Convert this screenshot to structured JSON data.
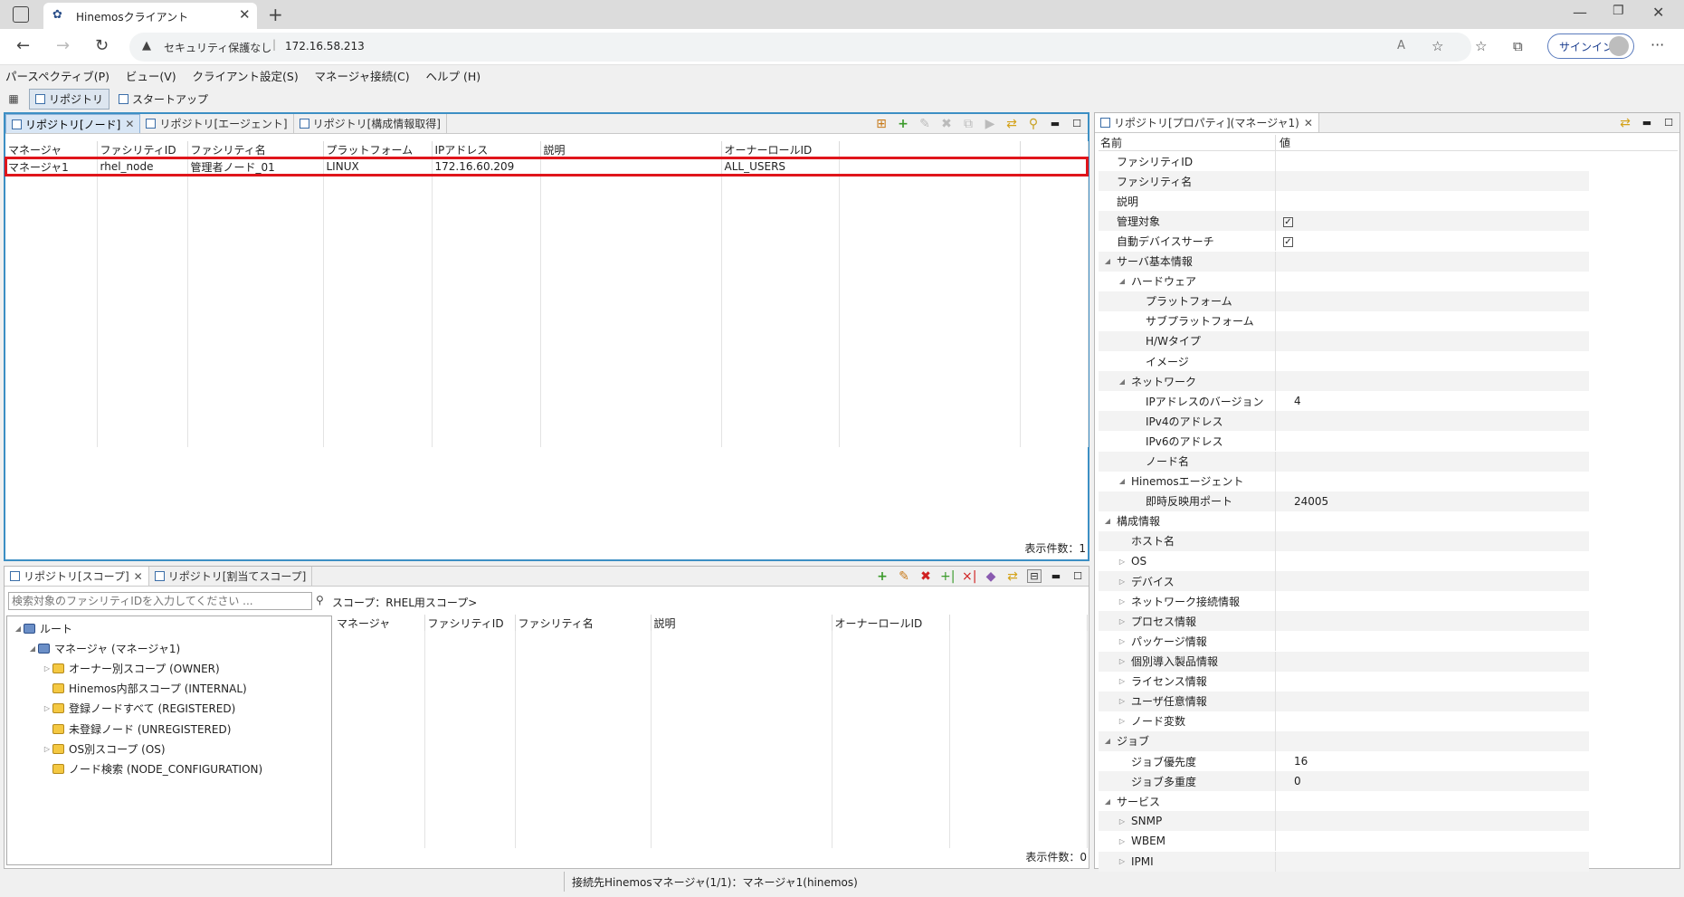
{
  "browser": {
    "tab_title": "Hinemosクライアント",
    "security_label": "セキュリティ保護なし",
    "url": "172.16.58.213",
    "signin_label": "サインイン"
  },
  "menubar": [
    "パースペクティブ(P)",
    "ビュー(V)",
    "クライアント設定(S)",
    "マネージャ接続(C)",
    "ヘルプ (H)"
  ],
  "perspectives": [
    "リポジトリ",
    "スタートアップ"
  ],
  "node_view": {
    "tabs": [
      "リポジトリ[ノード]",
      "リポジトリ[エージェント]",
      "リポジトリ[構成情報取得]"
    ],
    "columns": [
      "マネージャ",
      "ファシリティID",
      "ファシリティ名",
      "プラットフォーム",
      "IPアドレス",
      "説明",
      "オーナーロールID"
    ],
    "rows": [
      [
        "マネージャ1",
        "rhel_node",
        "管理者ノード_01",
        "LINUX",
        "172.16.60.209",
        "",
        "ALL_USERS"
      ]
    ],
    "count_label": "表示件数：1"
  },
  "scope_view": {
    "tabs": [
      "リポジトリ[スコープ]",
      "リポジトリ[割当てスコープ]"
    ],
    "search_placeholder": "検索対象のファシリティIDを入力してください ...",
    "scope_label": "スコープ：RHEL用スコープ>",
    "tree": [
      {
        "label": "ルート",
        "level": 0,
        "expander": "◢",
        "icon": "root"
      },
      {
        "label": "マネージャ (マネージャ1)",
        "level": 1,
        "expander": "◢",
        "icon": "manager"
      },
      {
        "label": "オーナー別スコープ (OWNER)",
        "level": 2,
        "expander": "▷",
        "icon": "folder"
      },
      {
        "label": "Hinemos内部スコープ (INTERNAL)",
        "level": 2,
        "expander": "",
        "icon": "folder"
      },
      {
        "label": "登録ノードすべて (REGISTERED)",
        "level": 2,
        "expander": "▷",
        "icon": "folder"
      },
      {
        "label": "未登録ノード (UNREGISTERED)",
        "level": 2,
        "expander": "",
        "icon": "folder"
      },
      {
        "label": "OS別スコープ (OS)",
        "level": 2,
        "expander": "▷",
        "icon": "folder"
      },
      {
        "label": "ノード検索 (NODE_CONFIGURATION)",
        "level": 2,
        "expander": "",
        "icon": "folder"
      }
    ],
    "columns": [
      "マネージャ",
      "ファシリティID",
      "ファシリティ名",
      "説明",
      "オーナーロールID"
    ],
    "count_label": "表示件数：0"
  },
  "property_view": {
    "tab": "リポジトリ[プロパティ](マネージャ1)",
    "col_name": "名前",
    "col_value": "値",
    "rows": [
      {
        "name": "ファシリティID",
        "level": 0,
        "expander": "",
        "value": ""
      },
      {
        "name": "ファシリティ名",
        "level": 0,
        "expander": "",
        "value": ""
      },
      {
        "name": "説明",
        "level": 0,
        "expander": "",
        "value": ""
      },
      {
        "name": "管理対象",
        "level": 0,
        "expander": "",
        "value": "",
        "checked": true
      },
      {
        "name": "自動デバイスサーチ",
        "level": 0,
        "expander": "",
        "value": "",
        "checked": true
      },
      {
        "name": "サーバ基本情報",
        "level": 0,
        "expander": "◢",
        "value": ""
      },
      {
        "name": "ハードウェア",
        "level": 1,
        "expander": "◢",
        "value": ""
      },
      {
        "name": "プラットフォーム",
        "level": 2,
        "expander": "",
        "value": ""
      },
      {
        "name": "サブプラットフォーム",
        "level": 2,
        "expander": "",
        "value": ""
      },
      {
        "name": "H/Wタイプ",
        "level": 2,
        "expander": "",
        "value": ""
      },
      {
        "name": "イメージ",
        "level": 2,
        "expander": "",
        "value": ""
      },
      {
        "name": "ネットワーク",
        "level": 1,
        "expander": "◢",
        "value": ""
      },
      {
        "name": "IPアドレスのバージョン",
        "level": 2,
        "expander": "",
        "value": "4"
      },
      {
        "name": "IPv4のアドレス",
        "level": 2,
        "expander": "",
        "value": ""
      },
      {
        "name": "IPv6のアドレス",
        "level": 2,
        "expander": "",
        "value": ""
      },
      {
        "name": "ノード名",
        "level": 2,
        "expander": "",
        "value": ""
      },
      {
        "name": "Hinemosエージェント",
        "level": 1,
        "expander": "◢",
        "value": ""
      },
      {
        "name": "即時反映用ポート",
        "level": 2,
        "expander": "",
        "value": "24005"
      },
      {
        "name": "構成情報",
        "level": 0,
        "expander": "◢",
        "value": ""
      },
      {
        "name": "ホスト名",
        "level": 1,
        "expander": "",
        "value": ""
      },
      {
        "name": "OS",
        "level": 1,
        "expander": "▷",
        "value": ""
      },
      {
        "name": "デバイス",
        "level": 1,
        "expander": "▷",
        "value": ""
      },
      {
        "name": "ネットワーク接続情報",
        "level": 1,
        "expander": "▷",
        "value": ""
      },
      {
        "name": "プロセス情報",
        "level": 1,
        "expander": "▷",
        "value": ""
      },
      {
        "name": "パッケージ情報",
        "level": 1,
        "expander": "▷",
        "value": ""
      },
      {
        "name": "個別導入製品情報",
        "level": 1,
        "expander": "▷",
        "value": ""
      },
      {
        "name": "ライセンス情報",
        "level": 1,
        "expander": "▷",
        "value": ""
      },
      {
        "name": "ユーザ任意情報",
        "level": 1,
        "expander": "▷",
        "value": ""
      },
      {
        "name": "ノード変数",
        "level": 1,
        "expander": "▷",
        "value": ""
      },
      {
        "name": "ジョブ",
        "level": 0,
        "expander": "◢",
        "value": ""
      },
      {
        "name": "ジョブ優先度",
        "level": 1,
        "expander": "",
        "value": "16"
      },
      {
        "name": "ジョブ多重度",
        "level": 1,
        "expander": "",
        "value": "0"
      },
      {
        "name": "サービス",
        "level": 0,
        "expander": "◢",
        "value": ""
      },
      {
        "name": "SNMP",
        "level": 1,
        "expander": "▷",
        "value": ""
      },
      {
        "name": "WBEM",
        "level": 1,
        "expander": "▷",
        "value": ""
      },
      {
        "name": "IPMI",
        "level": 1,
        "expander": "▷",
        "value": ""
      }
    ]
  },
  "status_bar": "接続先Hinemosマネージャ(1/1)：マネージャ1(hinemos)",
  "colors": {
    "highlight": "#e0151b",
    "active_tab": "#d8e6f5",
    "panel_border": "#3c8fc4"
  }
}
